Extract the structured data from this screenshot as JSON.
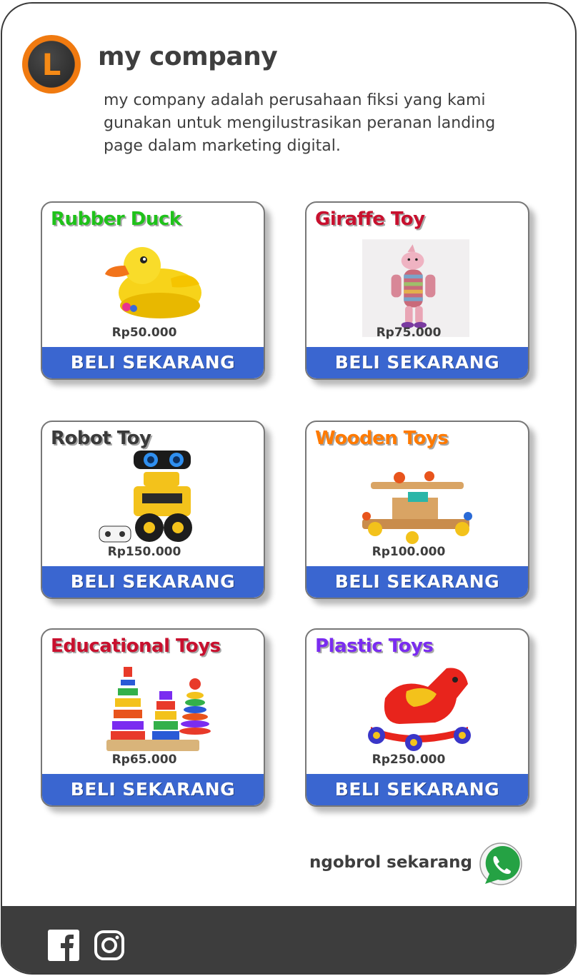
{
  "header": {
    "logo_letter": "L",
    "title": "my company",
    "description": "my company adalah perusahaan fiksi yang kami gunakan untuk mengilustrasikan peranan landing page dalam marketing digital."
  },
  "products": [
    {
      "name": "Rubber Duck",
      "price": "Rp50.000",
      "button": "BELI SEKARANG",
      "title_color": "#1fc21a",
      "image": "rubber-duck"
    },
    {
      "name": "Giraffe Toy",
      "price": "Rp75.000",
      "button": "BELI SEKARANG",
      "title_color": "#c8102e",
      "image": "giraffe-plush"
    },
    {
      "name": "Robot Toy",
      "price": "Rp150.000",
      "button": "BELI SEKARANG",
      "title_color": "#3a3a3a",
      "image": "yellow-robot"
    },
    {
      "name": "Wooden Toys",
      "price": "Rp100.000",
      "button": "BELI SEKARANG",
      "title_color": "#ff7a00",
      "image": "wooden-construction-toy"
    },
    {
      "name": "Educational Toys",
      "price": "Rp65.000",
      "button": "BELI SEKARANG",
      "title_color": "#c8102e",
      "image": "stacking-rings"
    },
    {
      "name": "Plastic Toys",
      "price": "Rp250.000",
      "button": "BELI SEKARANG",
      "title_color": "#7a2cf0",
      "image": "red-rocking-horse"
    }
  ],
  "chat": {
    "label": "ngobrol sekarang",
    "icon": "whatsapp-icon"
  },
  "footer": {
    "icons": [
      "facebook-icon",
      "instagram-icon"
    ]
  },
  "colors": {
    "button": "#3a66d0",
    "footer": "#3d3d3d",
    "accent": "#f07a10"
  }
}
